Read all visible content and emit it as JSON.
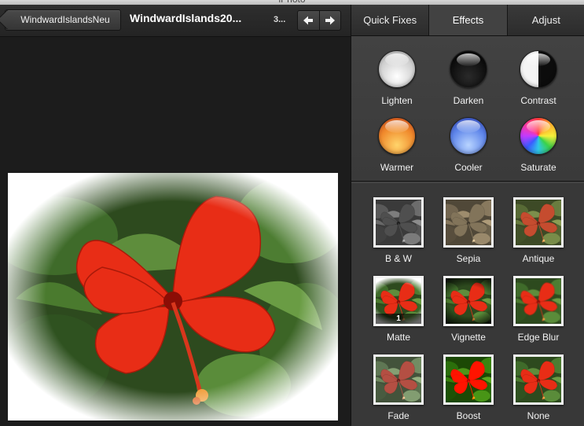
{
  "window": {
    "title": "iPhoto"
  },
  "toolbar": {
    "back_label": "WindwardIslandsNeu",
    "photo_title": "WindwardIslands20...",
    "photo_count": "3...",
    "prev_icon": "arrow-left-icon",
    "next_icon": "arrow-right-icon"
  },
  "tabs": [
    {
      "label": "Quick Fixes",
      "active": false
    },
    {
      "label": "Effects",
      "active": true
    },
    {
      "label": "Adjust",
      "active": false
    }
  ],
  "orb_effects": [
    {
      "label": "Lighten",
      "color": "#e8e8e8"
    },
    {
      "label": "Darken",
      "color": "#111111"
    },
    {
      "label": "Contrast",
      "color": "#888888"
    },
    {
      "label": "Warmer",
      "color": "#f07a2a"
    },
    {
      "label": "Cooler",
      "color": "#5b82e6"
    },
    {
      "label": "Saturate",
      "color": "#d94a8c"
    }
  ],
  "thumb_effects": [
    {
      "label": "B & W",
      "filter": "grayscale(1) contrast(1.1)"
    },
    {
      "label": "Sepia",
      "filter": "sepia(1)"
    },
    {
      "label": "Antique",
      "filter": "sepia(0.5) saturate(1.2)"
    },
    {
      "label": "Matte",
      "filter": "none",
      "badge": "1"
    },
    {
      "label": "Vignette",
      "filter": "none"
    },
    {
      "label": "Edge Blur",
      "filter": "blur(0.4px)"
    },
    {
      "label": "Fade",
      "filter": "saturate(0.45) brightness(1.2)"
    },
    {
      "label": "Boost",
      "filter": "saturate(1.4) contrast(1.1)"
    },
    {
      "label": "None",
      "filter": "none"
    }
  ]
}
